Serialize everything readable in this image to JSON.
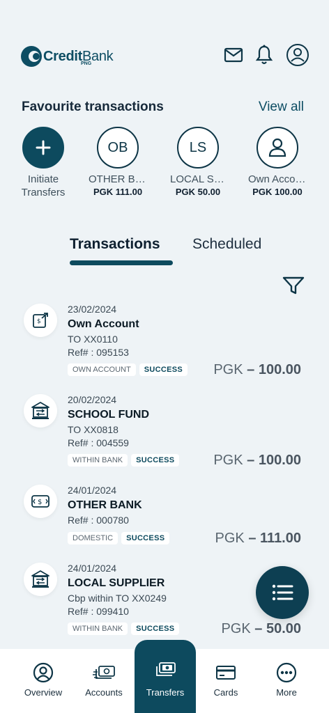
{
  "header": {
    "brand": "CreditBank",
    "brand_bold": "Credit",
    "brand_thin": "Bank",
    "brand_sub": "PNG",
    "icons": [
      "mail-icon",
      "bell-icon",
      "profile-icon"
    ]
  },
  "favourites": {
    "title": "Favourite transactions",
    "view_all": "View all",
    "items": [
      {
        "initials": "+",
        "name1": "Initiate",
        "name2": "Transfers",
        "amount": ""
      },
      {
        "initials": "OB",
        "name1": "OTHER BANK",
        "amount": "PGK 111.00"
      },
      {
        "initials": "LS",
        "name1": "LOCAL SUPPLIER",
        "amount": "PGK 50.00"
      },
      {
        "initials": "",
        "name1": "Own Account",
        "amount": "PGK 100.00"
      }
    ]
  },
  "tabs": {
    "active": "Transactions",
    "inactive": "Scheduled"
  },
  "transactions": [
    {
      "date": "23/02/2024",
      "name": "Own Account",
      "line1": "TO XX0110",
      "line2": "Ref# : 095153",
      "tag": "OWN ACCOUNT",
      "status": "SUCCESS",
      "currency": "PGK",
      "amount": "– 100.00"
    },
    {
      "date": "20/02/2024",
      "name": "SCHOOL FUND",
      "line1": "TO XX0818",
      "line2": "Ref# : 004559",
      "tag": "WITHIN BANK",
      "status": "SUCCESS",
      "currency": "PGK",
      "amount": "– 100.00"
    },
    {
      "date": "24/01/2024",
      "name": "OTHER BANK",
      "line1": "Ref# : 000780",
      "line2": "",
      "tag": "DOMESTIC",
      "status": "SUCCESS",
      "currency": "PGK",
      "amount": "– 111.00"
    },
    {
      "date": "24/01/2024",
      "name": "LOCAL SUPPLIER",
      "line1": "Cbp within TO XX0249",
      "line2": "Ref# : 099410",
      "tag": "WITHIN BANK",
      "status": "SUCCESS",
      "currency": "PGK",
      "amount": "– 50.00"
    }
  ],
  "nav": {
    "overview": "Overview",
    "accounts": "Accounts",
    "transfers": "Transfers",
    "cards": "Cards",
    "more": "More"
  },
  "colors": {
    "primary": "#0d4a5e",
    "background": "#eef3f6"
  }
}
